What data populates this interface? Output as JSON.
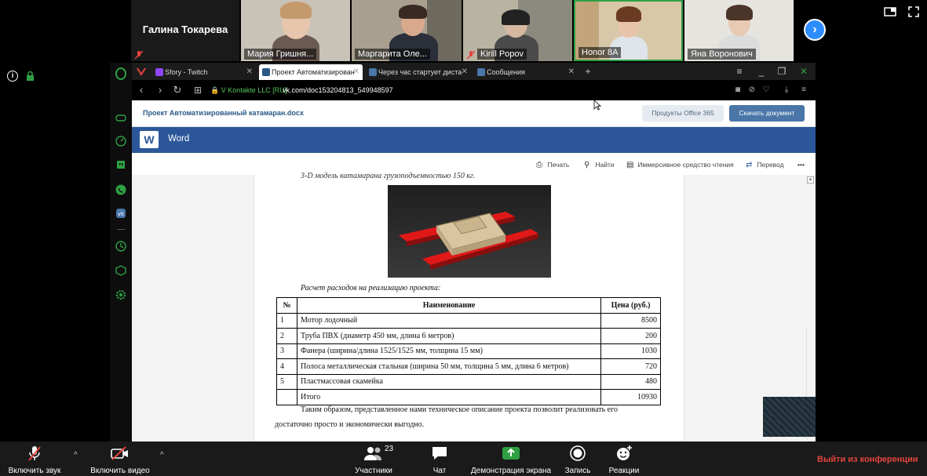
{
  "participants": [
    {
      "name": "Галина Токарева",
      "muted": true,
      "video": false
    },
    {
      "name": "Мария Гришня...",
      "muted": false,
      "video": true
    },
    {
      "name": "Маргарита Оле...",
      "muted": false,
      "video": true
    },
    {
      "name": "Kirill Popov",
      "muted": true,
      "video": true
    },
    {
      "name": "Honor 8A",
      "muted": false,
      "video": true,
      "active": true
    },
    {
      "name": "Яна Воронович",
      "muted": false,
      "video": true
    }
  ],
  "browser": {
    "tabs": [
      {
        "label": "Sfory - Twitch",
        "favicon_color": "#9146ff"
      },
      {
        "label": "Проект Автоматизирован",
        "favicon_color": "#2a5885",
        "active": true
      },
      {
        "label": "Через час стартует диста",
        "favicon_color": "#4a76a8"
      },
      {
        "label": "Сообщения",
        "favicon_color": "#4a76a8"
      }
    ],
    "site_badge": "V Kontakte LLC [RU]",
    "url": "vk.com/doc153204813_549948597"
  },
  "vk": {
    "doc_title": "Проект Автоматизированный катамаран.docx",
    "office_button": "Продукты Office 365",
    "download_button": "Скачать документ"
  },
  "word": {
    "app_name": "Word",
    "logo_letter": "W",
    "commands": {
      "print": "Печать",
      "find": "Найти",
      "immersive": "Иммерсивное средство чтения",
      "translate": "Перевод",
      "more": "•••"
    }
  },
  "document": {
    "caption_top": "3-D модель катамарана грузоподъемностью 150 кг.",
    "caption_costs": "Расчет расходов на реализацию проекта:",
    "table": {
      "headers": [
        "№",
        "Наименование",
        "Цена (руб.)"
      ],
      "rows": [
        [
          "1",
          "Мотор лодочный",
          "8500"
        ],
        [
          "2",
          "Труба ПВХ (диаметр 450 мм, длина 6 метров)",
          "200"
        ],
        [
          "3",
          "Фанера (ширина/длина 1525/1525 мм, толщина 15 мм)",
          "1030"
        ],
        [
          "4",
          "Полоса металлическая стальная (ширина 50 мм, толщина 5 мм, длина 6 метров)",
          "720"
        ],
        [
          "5",
          "Пластмассовая скамейка",
          "480"
        ],
        [
          "",
          "Итого",
          "10930"
        ]
      ]
    },
    "conclusion_line1": "Таким образом, представленное нами техническое описание проекта позволит реализовать его",
    "conclusion_line2": "достаточно просто и экономически выгодно."
  },
  "toolbar": {
    "unmute": "Включить звук",
    "start_video": "Включить видео",
    "participants": "Участники",
    "participants_count": "23",
    "chat": "Чат",
    "share_screen": "Демонстрация экрана",
    "record": "Запись",
    "reactions": "Реакции",
    "leave": "Выйти из конференции"
  },
  "colors": {
    "zoom_blue": "#2d8cff",
    "vk_blue": "#4a76a8",
    "word_blue": "#2b579a",
    "leave_red": "#e5443f",
    "share_green": "#2ea043"
  }
}
